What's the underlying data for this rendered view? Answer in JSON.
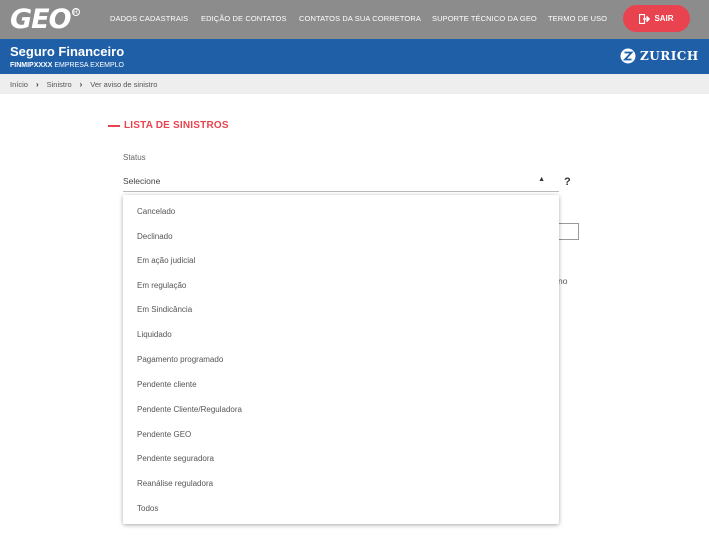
{
  "brand": {
    "logo": "GEO"
  },
  "nav": {
    "links": [
      "DADOS CADASTRAIS",
      "EDIÇÃO DE CONTATOS",
      "CONTATOS DA SUA CORRETORA",
      "SUPORTE TÉCNICO DA GEO",
      "TERMO DE USO"
    ],
    "logout_label": "SAIR"
  },
  "header": {
    "product_title": "Seguro Financeiro",
    "product_code": "FINMIPXXXX",
    "company": "EMPRESA EXEMPLO",
    "partner": "ZURICH"
  },
  "breadcrumb": [
    "Início",
    "Sinistro",
    "Ver aviso de sinistro"
  ],
  "main": {
    "section_title": "LISTA DE SINISTROS",
    "status_label": "Status",
    "status_value": "Selecione",
    "help": "?",
    "background_text_fragment": "no"
  },
  "dropdown": {
    "options": [
      "Cancelado",
      "Declinado",
      "Em ação judicial",
      "Em regulação",
      "Em Sindicância",
      "Liquidado",
      "Pagamento programado",
      "Pendente cliente",
      "Pendente Cliente/Reguladora",
      "Pendente GEO",
      "Pendente seguradora",
      "Reanálise reguladora",
      "Todos"
    ]
  },
  "colors": {
    "nav_bg": "#8c8c8c",
    "header_bg": "#1f5fa8",
    "accent": "#e8434f"
  }
}
